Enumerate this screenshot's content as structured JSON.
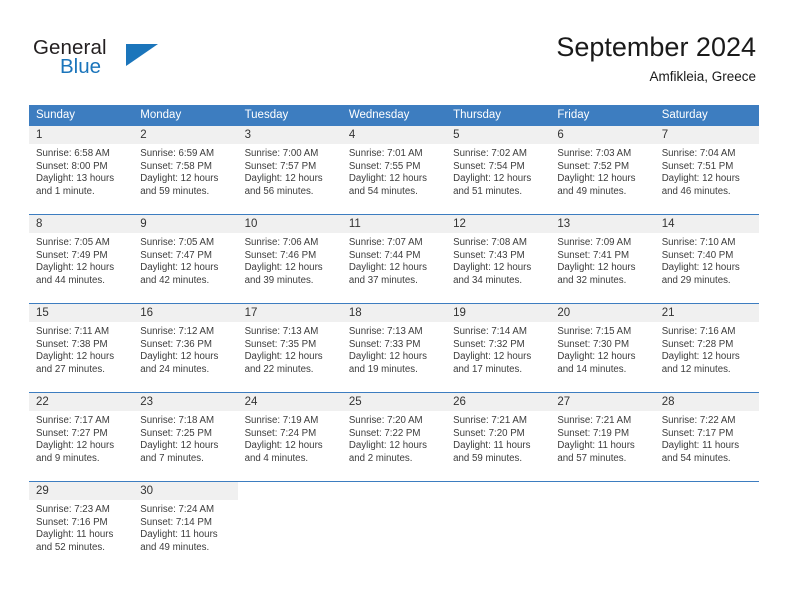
{
  "brand": {
    "name_top": "General",
    "name_bottom": "Blue"
  },
  "header": {
    "title": "September 2024",
    "location": "Amfikleia, Greece"
  },
  "colors": {
    "header_blue": "#3d7dc0",
    "brand_blue": "#1b75bb",
    "daynum_bg": "#f0f0f0",
    "text": "#3c3c3c"
  },
  "weekdays": [
    "Sunday",
    "Monday",
    "Tuesday",
    "Wednesday",
    "Thursday",
    "Friday",
    "Saturday"
  ],
  "weeks": [
    [
      {
        "day": "1",
        "sunrise": "Sunrise: 6:58 AM",
        "sunset": "Sunset: 8:00 PM",
        "daylight1": "Daylight: 13 hours",
        "daylight2": "and 1 minute."
      },
      {
        "day": "2",
        "sunrise": "Sunrise: 6:59 AM",
        "sunset": "Sunset: 7:58 PM",
        "daylight1": "Daylight: 12 hours",
        "daylight2": "and 59 minutes."
      },
      {
        "day": "3",
        "sunrise": "Sunrise: 7:00 AM",
        "sunset": "Sunset: 7:57 PM",
        "daylight1": "Daylight: 12 hours",
        "daylight2": "and 56 minutes."
      },
      {
        "day": "4",
        "sunrise": "Sunrise: 7:01 AM",
        "sunset": "Sunset: 7:55 PM",
        "daylight1": "Daylight: 12 hours",
        "daylight2": "and 54 minutes."
      },
      {
        "day": "5",
        "sunrise": "Sunrise: 7:02 AM",
        "sunset": "Sunset: 7:54 PM",
        "daylight1": "Daylight: 12 hours",
        "daylight2": "and 51 minutes."
      },
      {
        "day": "6",
        "sunrise": "Sunrise: 7:03 AM",
        "sunset": "Sunset: 7:52 PM",
        "daylight1": "Daylight: 12 hours",
        "daylight2": "and 49 minutes."
      },
      {
        "day": "7",
        "sunrise": "Sunrise: 7:04 AM",
        "sunset": "Sunset: 7:51 PM",
        "daylight1": "Daylight: 12 hours",
        "daylight2": "and 46 minutes."
      }
    ],
    [
      {
        "day": "8",
        "sunrise": "Sunrise: 7:05 AM",
        "sunset": "Sunset: 7:49 PM",
        "daylight1": "Daylight: 12 hours",
        "daylight2": "and 44 minutes."
      },
      {
        "day": "9",
        "sunrise": "Sunrise: 7:05 AM",
        "sunset": "Sunset: 7:47 PM",
        "daylight1": "Daylight: 12 hours",
        "daylight2": "and 42 minutes."
      },
      {
        "day": "10",
        "sunrise": "Sunrise: 7:06 AM",
        "sunset": "Sunset: 7:46 PM",
        "daylight1": "Daylight: 12 hours",
        "daylight2": "and 39 minutes."
      },
      {
        "day": "11",
        "sunrise": "Sunrise: 7:07 AM",
        "sunset": "Sunset: 7:44 PM",
        "daylight1": "Daylight: 12 hours",
        "daylight2": "and 37 minutes."
      },
      {
        "day": "12",
        "sunrise": "Sunrise: 7:08 AM",
        "sunset": "Sunset: 7:43 PM",
        "daylight1": "Daylight: 12 hours",
        "daylight2": "and 34 minutes."
      },
      {
        "day": "13",
        "sunrise": "Sunrise: 7:09 AM",
        "sunset": "Sunset: 7:41 PM",
        "daylight1": "Daylight: 12 hours",
        "daylight2": "and 32 minutes."
      },
      {
        "day": "14",
        "sunrise": "Sunrise: 7:10 AM",
        "sunset": "Sunset: 7:40 PM",
        "daylight1": "Daylight: 12 hours",
        "daylight2": "and 29 minutes."
      }
    ],
    [
      {
        "day": "15",
        "sunrise": "Sunrise: 7:11 AM",
        "sunset": "Sunset: 7:38 PM",
        "daylight1": "Daylight: 12 hours",
        "daylight2": "and 27 minutes."
      },
      {
        "day": "16",
        "sunrise": "Sunrise: 7:12 AM",
        "sunset": "Sunset: 7:36 PM",
        "daylight1": "Daylight: 12 hours",
        "daylight2": "and 24 minutes."
      },
      {
        "day": "17",
        "sunrise": "Sunrise: 7:13 AM",
        "sunset": "Sunset: 7:35 PM",
        "daylight1": "Daylight: 12 hours",
        "daylight2": "and 22 minutes."
      },
      {
        "day": "18",
        "sunrise": "Sunrise: 7:13 AM",
        "sunset": "Sunset: 7:33 PM",
        "daylight1": "Daylight: 12 hours",
        "daylight2": "and 19 minutes."
      },
      {
        "day": "19",
        "sunrise": "Sunrise: 7:14 AM",
        "sunset": "Sunset: 7:32 PM",
        "daylight1": "Daylight: 12 hours",
        "daylight2": "and 17 minutes."
      },
      {
        "day": "20",
        "sunrise": "Sunrise: 7:15 AM",
        "sunset": "Sunset: 7:30 PM",
        "daylight1": "Daylight: 12 hours",
        "daylight2": "and 14 minutes."
      },
      {
        "day": "21",
        "sunrise": "Sunrise: 7:16 AM",
        "sunset": "Sunset: 7:28 PM",
        "daylight1": "Daylight: 12 hours",
        "daylight2": "and 12 minutes."
      }
    ],
    [
      {
        "day": "22",
        "sunrise": "Sunrise: 7:17 AM",
        "sunset": "Sunset: 7:27 PM",
        "daylight1": "Daylight: 12 hours",
        "daylight2": "and 9 minutes."
      },
      {
        "day": "23",
        "sunrise": "Sunrise: 7:18 AM",
        "sunset": "Sunset: 7:25 PM",
        "daylight1": "Daylight: 12 hours",
        "daylight2": "and 7 minutes."
      },
      {
        "day": "24",
        "sunrise": "Sunrise: 7:19 AM",
        "sunset": "Sunset: 7:24 PM",
        "daylight1": "Daylight: 12 hours",
        "daylight2": "and 4 minutes."
      },
      {
        "day": "25",
        "sunrise": "Sunrise: 7:20 AM",
        "sunset": "Sunset: 7:22 PM",
        "daylight1": "Daylight: 12 hours",
        "daylight2": "and 2 minutes."
      },
      {
        "day": "26",
        "sunrise": "Sunrise: 7:21 AM",
        "sunset": "Sunset: 7:20 PM",
        "daylight1": "Daylight: 11 hours",
        "daylight2": "and 59 minutes."
      },
      {
        "day": "27",
        "sunrise": "Sunrise: 7:21 AM",
        "sunset": "Sunset: 7:19 PM",
        "daylight1": "Daylight: 11 hours",
        "daylight2": "and 57 minutes."
      },
      {
        "day": "28",
        "sunrise": "Sunrise: 7:22 AM",
        "sunset": "Sunset: 7:17 PM",
        "daylight1": "Daylight: 11 hours",
        "daylight2": "and 54 minutes."
      }
    ],
    [
      {
        "day": "29",
        "sunrise": "Sunrise: 7:23 AM",
        "sunset": "Sunset: 7:16 PM",
        "daylight1": "Daylight: 11 hours",
        "daylight2": "and 52 minutes."
      },
      {
        "day": "30",
        "sunrise": "Sunrise: 7:24 AM",
        "sunset": "Sunset: 7:14 PM",
        "daylight1": "Daylight: 11 hours",
        "daylight2": "and 49 minutes."
      },
      {
        "day": "",
        "sunrise": "",
        "sunset": "",
        "daylight1": "",
        "daylight2": ""
      },
      {
        "day": "",
        "sunrise": "",
        "sunset": "",
        "daylight1": "",
        "daylight2": ""
      },
      {
        "day": "",
        "sunrise": "",
        "sunset": "",
        "daylight1": "",
        "daylight2": ""
      },
      {
        "day": "",
        "sunrise": "",
        "sunset": "",
        "daylight1": "",
        "daylight2": ""
      },
      {
        "day": "",
        "sunrise": "",
        "sunset": "",
        "daylight1": "",
        "daylight2": ""
      }
    ]
  ]
}
